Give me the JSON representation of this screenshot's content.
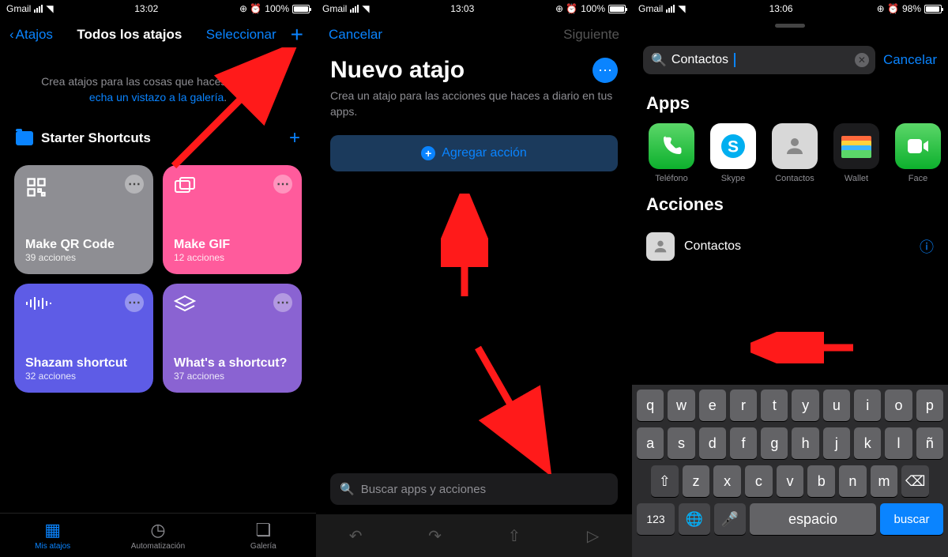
{
  "screen1": {
    "status": {
      "carrier": "Gmail",
      "time": "13:02",
      "battery": "100%"
    },
    "nav": {
      "back": "Atajos",
      "title": "Todos los atajos",
      "select": "Seleccionar"
    },
    "intro_line1": "Crea atajos para las cosas que haces a diario o",
    "intro_link": "echa un vistazo a la galería",
    "folder": "Starter Shortcuts",
    "cards": [
      {
        "title": "Make QR Code",
        "sub": "39 acciones"
      },
      {
        "title": "Make GIF",
        "sub": "12 acciones"
      },
      {
        "title": "Shazam shortcut",
        "sub": "32 acciones"
      },
      {
        "title": "What's a shortcut?",
        "sub": "37 acciones"
      }
    ],
    "tabs": {
      "my": "Mis atajos",
      "auto": "Automatización",
      "gallery": "Galería"
    }
  },
  "screen2": {
    "status": {
      "carrier": "Gmail",
      "time": "13:03",
      "battery": "100%"
    },
    "cancel": "Cancelar",
    "next": "Siguiente",
    "title": "Nuevo atajo",
    "desc": "Crea un atajo para las acciones que haces a diario en tus apps.",
    "add": "Agregar acción",
    "search_placeholder": "Buscar apps y acciones"
  },
  "screen3": {
    "status": {
      "carrier": "Gmail",
      "time": "13:06",
      "battery": "98%"
    },
    "search_value": "Contactos",
    "cancel": "Cancelar",
    "apps_header": "Apps",
    "apps": [
      {
        "label": "Teléfono"
      },
      {
        "label": "Skype"
      },
      {
        "label": "Contactos"
      },
      {
        "label": "Wallet"
      },
      {
        "label": "Face"
      }
    ],
    "actions_header": "Acciones",
    "action_contactos": "Contactos",
    "keyboard": {
      "row1": [
        "q",
        "w",
        "e",
        "r",
        "t",
        "y",
        "u",
        "i",
        "o",
        "p"
      ],
      "row2": [
        "a",
        "s",
        "d",
        "f",
        "g",
        "h",
        "j",
        "k",
        "l",
        "ñ"
      ],
      "row3": [
        "z",
        "x",
        "c",
        "v",
        "b",
        "n",
        "m"
      ],
      "num": "123",
      "space": "espacio",
      "search": "buscar"
    }
  }
}
